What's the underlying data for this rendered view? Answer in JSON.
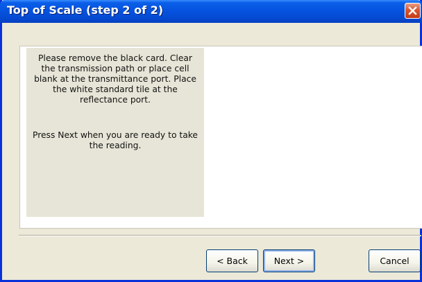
{
  "window": {
    "title": "Top of Scale (step 2 of 2)",
    "close_icon": "close-icon"
  },
  "instructions": {
    "paragraph1": "Please remove the black card.  Clear\nthe transmission path or place cell\nblank at the transmittance port.  Place\nthe white standard tile at the\nreflectance port.",
    "paragraph2": "Press Next when you are ready to take\nthe reading."
  },
  "buttons": {
    "back": "< Back",
    "next": "Next >",
    "cancel": "Cancel"
  },
  "colors": {
    "titlebar": "#0654e0",
    "close_button": "#d9542f",
    "dialog_background": "#ece9d8",
    "instruction_panel": "#e7e5d7"
  }
}
